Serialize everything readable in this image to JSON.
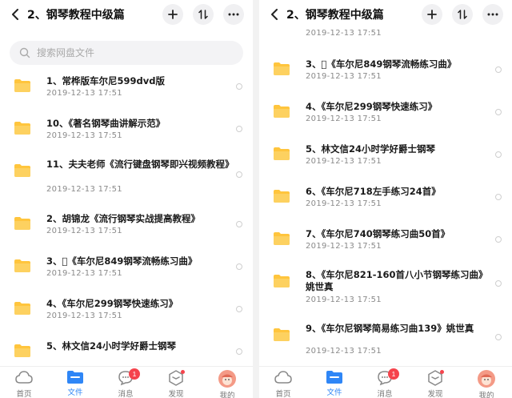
{
  "colors": {
    "accent": "#2f86f6",
    "folder": "#ffc53d",
    "badge": "#f5434c"
  },
  "left": {
    "header": {
      "title": "2、钢琴教程中级篇",
      "back_icon": "chevron-left-icon",
      "add_icon": "plus-icon",
      "sort_icon": "sort-icon",
      "more_icon": "more-dots-icon"
    },
    "search": {
      "placeholder": "搜索网盘文件"
    },
    "items": [
      {
        "name": "1、常桦版车尔尼599dvd版",
        "date": "2019-12-13  17:51"
      },
      {
        "name": "10、《著名钢琴曲讲解示范》",
        "date": "2019-12-13  17:51"
      },
      {
        "name": "11、夫夫老师《流行键盘钢琴即兴视频教程》",
        "date": "2019-12-13  17:51"
      },
      {
        "name": "2、胡锦龙《流行钢琴实战提高教程》",
        "date": "2019-12-13  17:51"
      },
      {
        "name": "3、\u0000《车尔尼849钢琴流畅练习曲》",
        "date": "2019-12-13  17:51"
      },
      {
        "name": "4、《车尔尼299钢琴快速练习》",
        "date": "2019-12-13  17:51"
      },
      {
        "name": "5、林文信24小时学好爵士钢琴",
        "date": ""
      }
    ]
  },
  "right": {
    "header": {
      "title": "2、钢琴教程中级篇"
    },
    "items": [
      {
        "name": "",
        "date": "2019-12-13  17:51"
      },
      {
        "name": "3、\u0000《车尔尼849钢琴流畅练习曲》",
        "date": "2019-12-13  17:51"
      },
      {
        "name": "4、《车尔尼299钢琴快速练习》",
        "date": "2019-12-13  17:51"
      },
      {
        "name": "5、林文信24小时学好爵士钢琴",
        "date": "2019-12-13  17:51"
      },
      {
        "name": "6、《车尔尼718左手练习24首》",
        "date": "2019-12-13  17:51"
      },
      {
        "name": "7、《车尔尼740钢琴练习曲50首》",
        "date": "2019-12-13  17:51"
      },
      {
        "name": "8、《车尔尼821-160首八小节钢琴练习曲》姚世真",
        "date": "2019-12-13  17:51"
      },
      {
        "name": "9、《车尔尼钢琴简易练习曲139》姚世真",
        "date": "2019-12-13  17:51"
      }
    ]
  },
  "nav": [
    {
      "label": "首页",
      "icon": "cloud-home-icon",
      "badge": ""
    },
    {
      "label": "文件",
      "icon": "folder-files-icon",
      "badge": ""
    },
    {
      "label": "消息",
      "icon": "chat-message-icon",
      "badge": "1"
    },
    {
      "label": "发现",
      "icon": "discover-cube-icon",
      "badge": "dot"
    },
    {
      "label": "我的",
      "icon": "avatar-icon",
      "badge": ""
    }
  ]
}
